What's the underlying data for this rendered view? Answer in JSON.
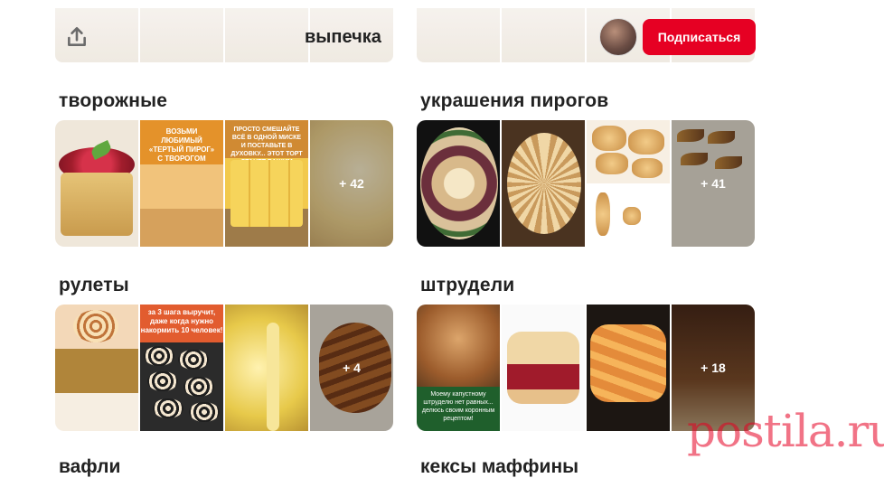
{
  "top": {
    "board_title": "выпечка",
    "subscribe_label": "Подписаться",
    "upload_icon": "upload-icon",
    "colors": {
      "subscribe": "#e60023"
    }
  },
  "boards": [
    {
      "title": "творожные",
      "more": "+ 42"
    },
    {
      "title": "украшения пирогов",
      "more": "+ 41"
    },
    {
      "title": "рулеты",
      "more": "+ 4"
    },
    {
      "title": "штрудели",
      "more": "+ 18"
    }
  ],
  "bottom_titles": [
    "вафли",
    "кексы маффины"
  ],
  "tiles": {
    "crumb_text": "ВОЗЬМИ ЛЮБИМЫЙ «ТЕРТЫЙ ПИРОГ» С ТВОРОГОМ",
    "lemon_text": "ПРОСТО СМЕШАЙТЕ ВСЁ В ОДНОЙ МИСКЕ И ПОСТАВЬТЕ В ДУХОВКУ... ЭТОТ ТОРТ СТАНЕТ ВАШИМ ЛЮБИМЫМ!",
    "poppy_text": "за 3 шага выручит, даже когда нужно накормить 10 человек!",
    "strudel_text": "Моему капустному штруделю нет равных... делюсь своим коронным рецептом!"
  },
  "watermark": "postila.ru"
}
